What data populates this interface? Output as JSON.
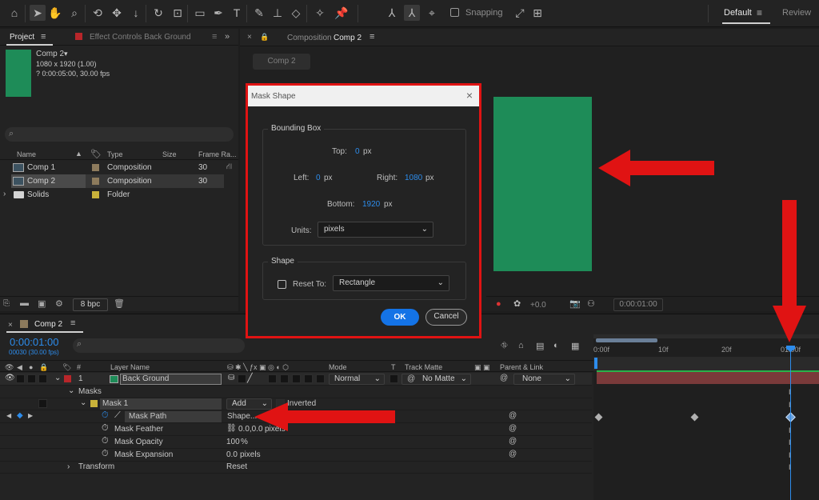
{
  "toolbar": {
    "snapping_label": "Snapping",
    "workspace_active": "Default",
    "workspace_other": "Review"
  },
  "project": {
    "tab_label": "Project",
    "effect_controls_tab": "Effect Controls Back Ground",
    "selected_name": "Comp 2",
    "selected_size": "1080 x 1920 (1.00)",
    "selected_duration": "? 0:00:05:00, 30.00 fps",
    "columns": [
      "Name",
      "Type",
      "Size",
      "Frame Ra..."
    ],
    "items": [
      {
        "name": "Comp 1",
        "type": "Composition",
        "frame_rate": "30"
      },
      {
        "name": "Comp 2",
        "type": "Composition",
        "frame_rate": "30"
      },
      {
        "name": "Solids",
        "type": "Folder",
        "frame_rate": ""
      }
    ],
    "bit_depth": "8 bpc"
  },
  "composition": {
    "tab_prefix": "Composition",
    "tab_name": "Comp 2",
    "breadcrumb": "Comp 2",
    "exposure": "+0.0",
    "timecode": "0:00:01:00",
    "solid_color": "#1e8c58"
  },
  "dialog": {
    "title": "Mask Shape",
    "bounding_box_label": "Bounding Box",
    "top_label": "Top:",
    "top_value": "0",
    "left_label": "Left:",
    "left_value": "0",
    "right_label": "Right:",
    "right_value": "1080",
    "bottom_label": "Bottom:",
    "bottom_value": "1920",
    "unit_suffix": "px",
    "units_label": "Units:",
    "units_value": "pixels",
    "shape_label": "Shape",
    "reset_label": "Reset To:",
    "reset_value": "Rectangle",
    "ok_label": "OK",
    "cancel_label": "Cancel"
  },
  "timeline": {
    "tab_name": "Comp 2",
    "current_time": "0:00:01:00",
    "frames": "00030 (30.00 fps)",
    "headers": {
      "hash": "#",
      "layer_name": "Layer Name",
      "mode": "Mode",
      "t": "T",
      "track_matte": "Track Matte",
      "parent": "Parent & Link"
    },
    "ruler": [
      "0:00f",
      "10f",
      "20f",
      "01:00f"
    ],
    "layer": {
      "number": "1",
      "name": "Back Ground",
      "mode": "Normal",
      "track_matte": "No Matte",
      "parent": "None"
    },
    "masks_label": "Masks",
    "mask_name": "Mask 1",
    "mask_mode": "Add",
    "inverted_label": "Inverted",
    "props": [
      {
        "name": "Mask Path",
        "value": "Shape..."
      },
      {
        "name": "Mask Feather",
        "value": "0.0,0.0",
        "unit": "pixels"
      },
      {
        "name": "Mask Opacity",
        "value": "100",
        "unit": "%"
      },
      {
        "name": "Mask Expansion",
        "value": "0.0",
        "unit": "pixels"
      }
    ],
    "transform_label": "Transform",
    "transform_value": "Reset"
  },
  "colors": {
    "accent_blue": "#2d8ceb",
    "arrow_red": "#e01313",
    "ok_blue": "#1473e6"
  }
}
